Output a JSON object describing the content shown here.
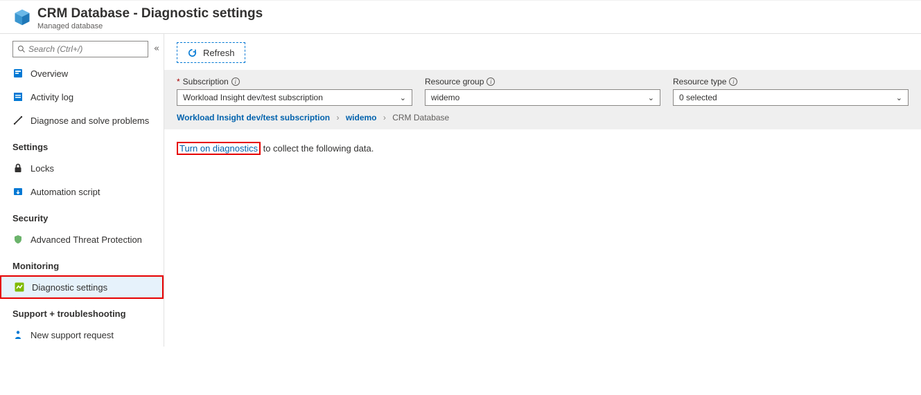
{
  "header": {
    "title": "CRM Database - Diagnostic settings",
    "subtitle": "Managed database"
  },
  "sidebar": {
    "search_placeholder": "Search (Ctrl+/)",
    "top": [
      {
        "label": "Overview"
      },
      {
        "label": "Activity log"
      },
      {
        "label": "Diagnose and solve problems"
      }
    ],
    "groups": {
      "settings": {
        "title": "Settings",
        "items": [
          {
            "label": "Locks"
          },
          {
            "label": "Automation script"
          }
        ]
      },
      "security": {
        "title": "Security",
        "items": [
          {
            "label": "Advanced Threat Protection"
          }
        ]
      },
      "monitoring": {
        "title": "Monitoring",
        "items": [
          {
            "label": "Diagnostic settings"
          }
        ]
      },
      "support": {
        "title": "Support + troubleshooting",
        "items": [
          {
            "label": "New support request"
          }
        ]
      }
    }
  },
  "toolbar": {
    "refresh_label": "Refresh"
  },
  "filters": {
    "subscription": {
      "label": "Subscription",
      "value": "Workload Insight dev/test subscription"
    },
    "resource_group": {
      "label": "Resource group",
      "value": "widemo"
    },
    "resource_type": {
      "label": "Resource type",
      "value": "0 selected"
    }
  },
  "breadcrumb": {
    "a": "Workload Insight dev/test subscription",
    "b": "widemo",
    "c": "CRM Database"
  },
  "content": {
    "link": "Turn on diagnostics",
    "rest": " to collect the following data."
  }
}
